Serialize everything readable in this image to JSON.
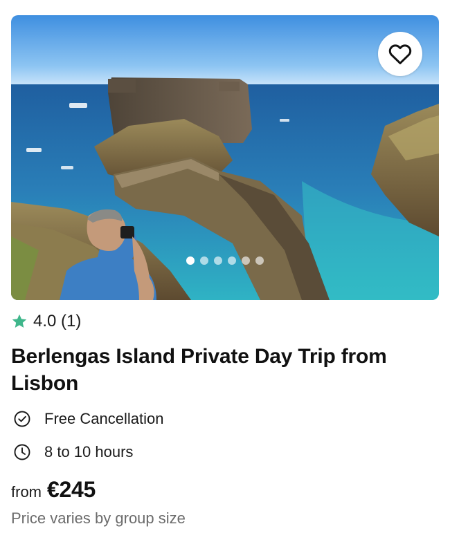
{
  "listing": {
    "image_alt": "Berlengas Island fort and stone bridge over the ocean",
    "favorite_icon": "heart-outline-icon",
    "carousel": {
      "dot_count": 6,
      "active_index": 0
    },
    "rating": {
      "icon": "star-icon",
      "star_color": "#3fb68b",
      "text": "4.0 (1)"
    },
    "title": "Berlengas Island Private Day Trip from Lisbon",
    "features": {
      "cancellation": {
        "icon": "check-circle-icon",
        "label": "Free Cancellation"
      },
      "duration": {
        "icon": "clock-icon",
        "label": "8 to 10 hours"
      }
    },
    "price": {
      "prefix": "from",
      "amount": "€245",
      "note": "Price varies by group size"
    }
  }
}
